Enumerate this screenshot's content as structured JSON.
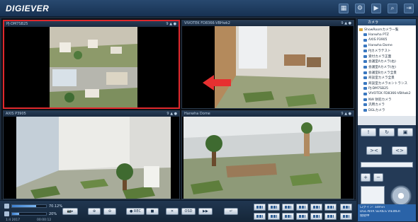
{
  "app": {
    "title": "DIGIEVER"
  },
  "top_icons": [
    "calendar-icon",
    "settings-icon",
    "playback-icon",
    "search-icon",
    "logout-icon"
  ],
  "panes": [
    {
      "title": "PJ-DM7SB25",
      "stat": "9 ▲ ●",
      "selected": true
    },
    {
      "title": "VIVOTEK FD8366-VBHwk2",
      "stat": "9 ▲ ●",
      "selected": false
    },
    {
      "title": "AXIS P3905",
      "stat": "9 ▲ ●",
      "selected": false
    },
    {
      "title": "Hanwha Dome",
      "stat": "9 ▲ ●",
      "selected": false
    }
  ],
  "accent": {
    "highlight": "#e0282c",
    "arrow": "#e63030"
  },
  "sidebar": {
    "header": "カメラ",
    "tree": [
      {
        "label": "ShowRoomカメラ一覧",
        "type": "folder"
      },
      {
        "label": "Hanwha PTZ",
        "type": "camera"
      },
      {
        "label": "AXIS P3905",
        "type": "camera"
      },
      {
        "label": "Hanwha Dome",
        "type": "camera"
      },
      {
        "label": "PJカメラテスト",
        "type": "camera"
      },
      {
        "label": "受付カメラ正面",
        "type": "camera"
      },
      {
        "label": "会議室Aカメラ(右)",
        "type": "camera"
      },
      {
        "label": "会議室Aカメラ(左)",
        "type": "camera"
      },
      {
        "label": "会議室Bカメラ全景",
        "type": "camera"
      },
      {
        "label": "商談室カメラ全景",
        "type": "camera"
      },
      {
        "label": "商談室カメラエントランス",
        "type": "camera"
      },
      {
        "label": "PJ-DM7SB25",
        "type": "camera"
      },
      {
        "label": "VIVOTEK FD8366-VBHwk2",
        "type": "camera"
      },
      {
        "label": "NW 防犯カメラ",
        "type": "camera"
      },
      {
        "label": "汎用カメラ",
        "type": "camera"
      },
      {
        "label": "DGLカメラ",
        "type": "camera"
      }
    ],
    "ptz": {
      "plus": "+",
      "minus": "−",
      "wide": "><",
      "tele": "<>"
    },
    "info": [
      "ログイン: admin",
      "DGL-NVR SERIES VIEWER",
      "接続中"
    ]
  },
  "bottom": {
    "volume_1": {
      "label": "70.12%",
      "level": 0.7
    },
    "volume_2": {
      "label": "20%",
      "level": 0.2
    },
    "snapshot_label": "📷▸",
    "zoom_in_label": "⊕",
    "zoom_out_label": "⊖",
    "record_label": "● REC",
    "stop_label": "■",
    "close_label": "✕",
    "osd_label": "OSD",
    "seq_label": "▶▶",
    "back_label": "↵",
    "status_left": "1:4 2017",
    "status_right": "00:00:12"
  }
}
